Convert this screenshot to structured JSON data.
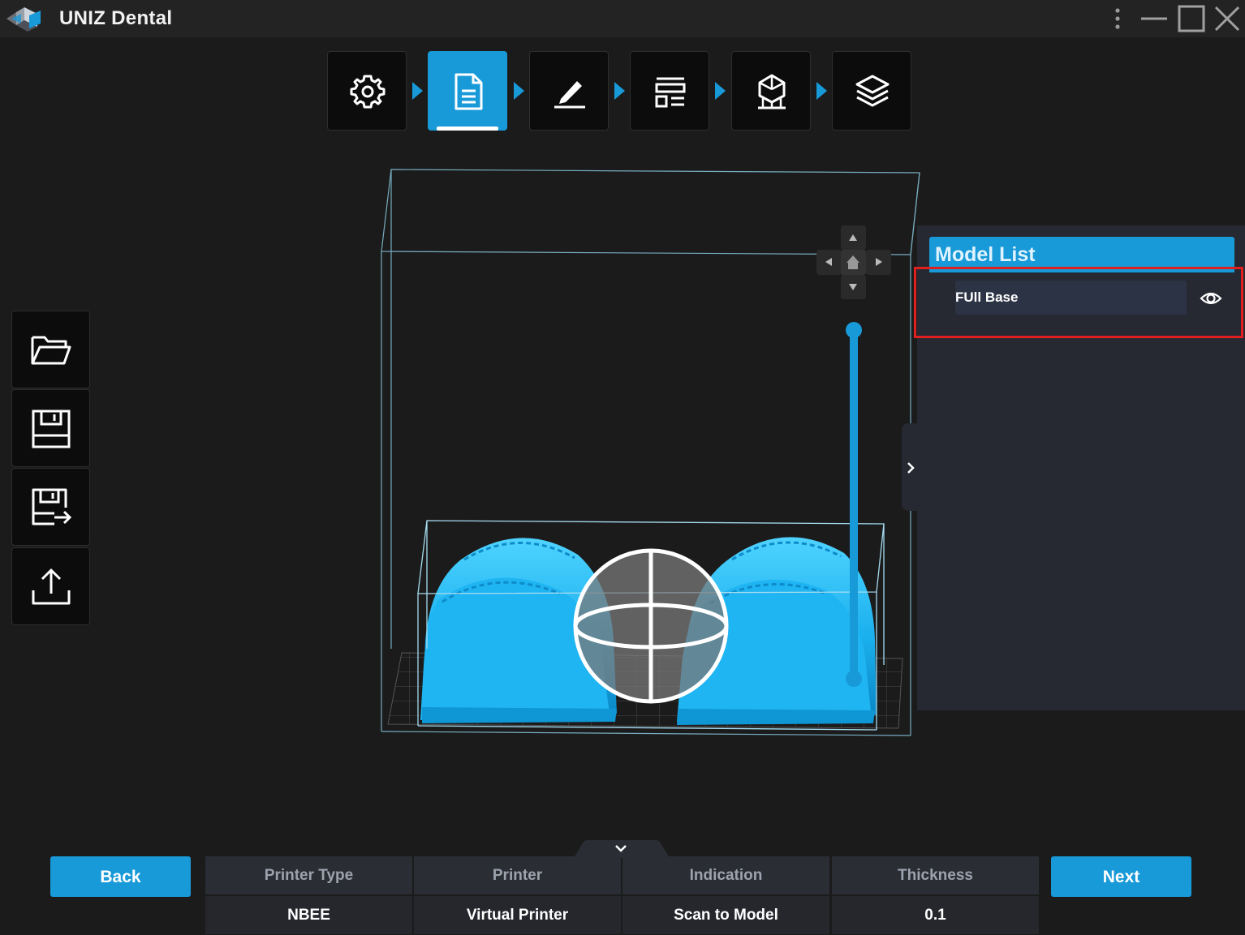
{
  "window": {
    "title": "UNIZ Dental",
    "controls": [
      "more-icon",
      "minimize-icon",
      "maximize-icon",
      "close-icon"
    ]
  },
  "steps": [
    {
      "name": "settings",
      "icon": "gear-icon",
      "active": false
    },
    {
      "name": "file",
      "icon": "document-icon",
      "active": true
    },
    {
      "name": "edit",
      "icon": "pen-icon",
      "active": false
    },
    {
      "name": "layout",
      "icon": "layout-icon",
      "active": false
    },
    {
      "name": "support",
      "icon": "support-structure-icon",
      "active": false
    },
    {
      "name": "slice",
      "icon": "layers-icon",
      "active": false
    }
  ],
  "toolbar": {
    "items": [
      "open-folder-icon",
      "save-icon",
      "save-as-icon",
      "upload-icon"
    ]
  },
  "model_list": {
    "title": "Model List",
    "items": [
      {
        "label": "FUll Base",
        "visible": true
      }
    ]
  },
  "bottom": {
    "back_label": "Back",
    "next_label": "Next",
    "info": [
      {
        "header": "Printer Type",
        "value": "NBEE"
      },
      {
        "header": "Printer",
        "value": "Virtual Printer"
      },
      {
        "header": "Indication",
        "value": "Scan to Model"
      },
      {
        "header": "Thickness",
        "value": "0.1"
      }
    ]
  },
  "colors": {
    "accent": "#1899d8",
    "model": "#22b2ef",
    "highlight": "#e11f1f",
    "panel": "#262932"
  }
}
